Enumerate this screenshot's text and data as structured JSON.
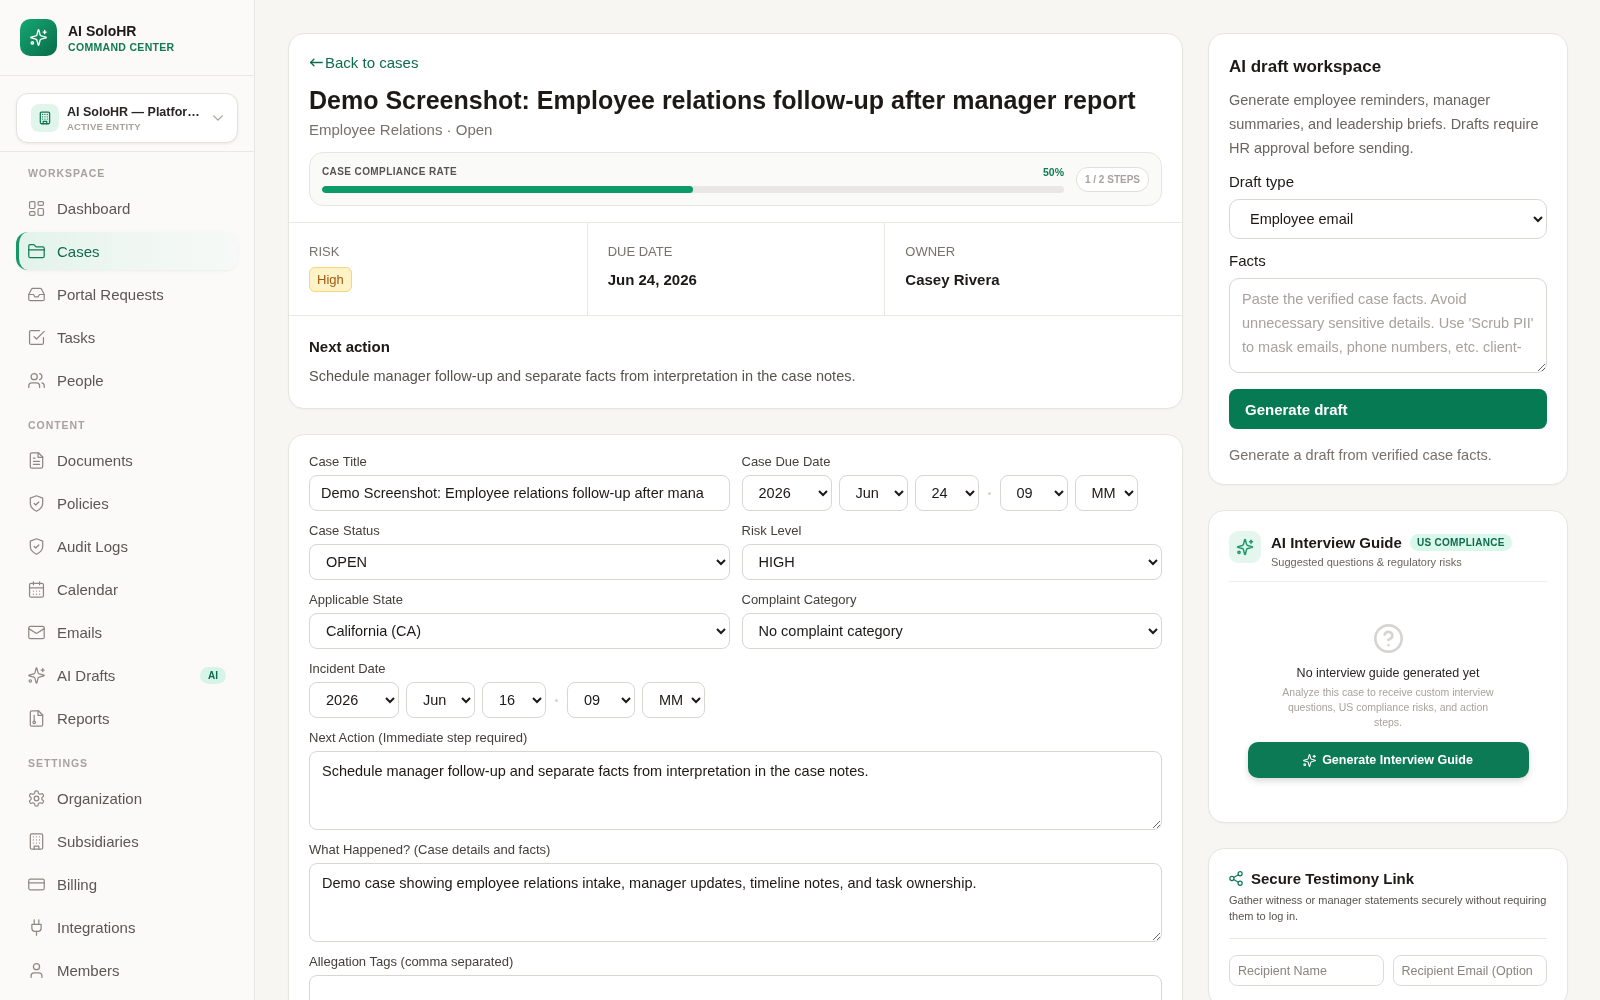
{
  "sidebar": {
    "brand": {
      "name": "AI SoloHR",
      "tagline": "COMMAND CENTER"
    },
    "entity": {
      "name": "AI SoloHR — Platfor…",
      "caption": "ACTIVE ENTITY"
    },
    "sections": [
      {
        "title": "WORKSPACE",
        "items": [
          {
            "label": "Dashboard",
            "selected": false
          },
          {
            "label": "Cases",
            "selected": true
          },
          {
            "label": "Portal Requests",
            "selected": false
          },
          {
            "label": "Tasks",
            "selected": false
          },
          {
            "label": "People",
            "selected": false
          }
        ]
      },
      {
        "title": "CONTENT",
        "items": [
          {
            "label": "Documents",
            "selected": false
          },
          {
            "label": "Policies",
            "selected": false
          },
          {
            "label": "Audit Logs",
            "selected": false
          },
          {
            "label": "Calendar",
            "selected": false
          },
          {
            "label": "Emails",
            "selected": false
          },
          {
            "label": "AI Drafts",
            "selected": false,
            "badge": "AI"
          },
          {
            "label": "Reports",
            "selected": false
          }
        ]
      },
      {
        "title": "SETTINGS",
        "items": [
          {
            "label": "Organization",
            "selected": false
          },
          {
            "label": "Subsidiaries",
            "selected": false
          },
          {
            "label": "Billing",
            "selected": false
          },
          {
            "label": "Integrations",
            "selected": false
          },
          {
            "label": "Members",
            "selected": false
          }
        ]
      }
    ]
  },
  "case": {
    "back_link": "Back to cases",
    "title": "Demo Screenshot: Employee relations follow-up after manager report",
    "subtitle": "Employee Relations · Open",
    "compliance": {
      "label": "CASE COMPLIANCE RATE",
      "reading": "50%",
      "level": 0.5,
      "steps": "1 / 2 STEPS"
    },
    "facts": [
      {
        "label": "RISK",
        "value": "High",
        "kind": "badge"
      },
      {
        "label": "DUE DATE",
        "value": "Jun 24, 2026",
        "kind": "text"
      },
      {
        "label": "OWNER",
        "value": "Casey Rivera",
        "kind": "text"
      }
    ],
    "next_action": {
      "title": "Next action",
      "text": "Schedule manager follow-up and separate facts from interpretation in the case notes."
    }
  },
  "case_form": {
    "rows": [
      [
        {
          "label": "Case Title",
          "kind": "text",
          "value": "Demo Screenshot: Employee relations follow-up after mana"
        },
        {
          "label": "Case Due Date",
          "kind": "datetime",
          "date": [
            "2026",
            "Jun",
            "24"
          ],
          "time": [
            "09",
            "MM"
          ]
        }
      ],
      [
        {
          "label": "Case Status",
          "kind": "select",
          "value": "OPEN"
        },
        {
          "label": "Risk Level",
          "kind": "select",
          "value": "HIGH"
        }
      ],
      [
        {
          "label": "Applicable State",
          "kind": "select",
          "value": "California (CA)"
        },
        {
          "label": "Complaint Category",
          "kind": "select",
          "value": "No complaint category"
        }
      ],
      [
        {
          "label": "Incident Date",
          "kind": "datetime",
          "date": [
            "2026",
            "Jun",
            "16"
          ],
          "time": [
            "09",
            "MM"
          ]
        }
      ],
      [
        {
          "label": "Next Action (Immediate step required)",
          "kind": "textarea",
          "value": "Schedule manager follow-up and separate facts from interpretation in the case notes."
        }
      ],
      [
        {
          "label": "What Happened? (Case details and facts)",
          "kind": "textarea",
          "value": "Demo case showing employee relations intake, manager updates, timeline notes, and task ownership."
        }
      ],
      [
        {
          "label": "Allegation Tags (comma separated)",
          "kind": "text"
        }
      ]
    ]
  },
  "draft_workspace": {
    "title": "AI draft workspace",
    "description": "Generate employee reminders, manager summaries, and leadership briefs. Drafts require HR approval before sending.",
    "draft_type": {
      "label": "Draft type",
      "value": "Employee email"
    },
    "facts": {
      "label": "Facts",
      "placeholder": "Paste the verified case facts. Avoid unnecessary sensitive details. Use 'Scrub PII' to mask emails, phone numbers, etc. client-"
    },
    "button": "Generate draft",
    "hint": "Generate a draft from verified case facts."
  },
  "interview_guide": {
    "title": "AI Interview Guide",
    "badge": "US COMPLIANCE",
    "subtitle": "Suggested questions & regulatory risks",
    "empty_title": "No interview guide generated yet",
    "empty_text": "Analyze this case to receive custom interview questions, US compliance risks, and action steps.",
    "button": "Generate Interview Guide"
  },
  "testimony_link": {
    "title": "Secure Testimony Link",
    "description": "Gather witness or manager statements securely without requiring them to log in.",
    "fields": [
      {
        "placeholder": "Recipient Name"
      },
      {
        "placeholder": "Recipient Email (Option"
      }
    ]
  }
}
